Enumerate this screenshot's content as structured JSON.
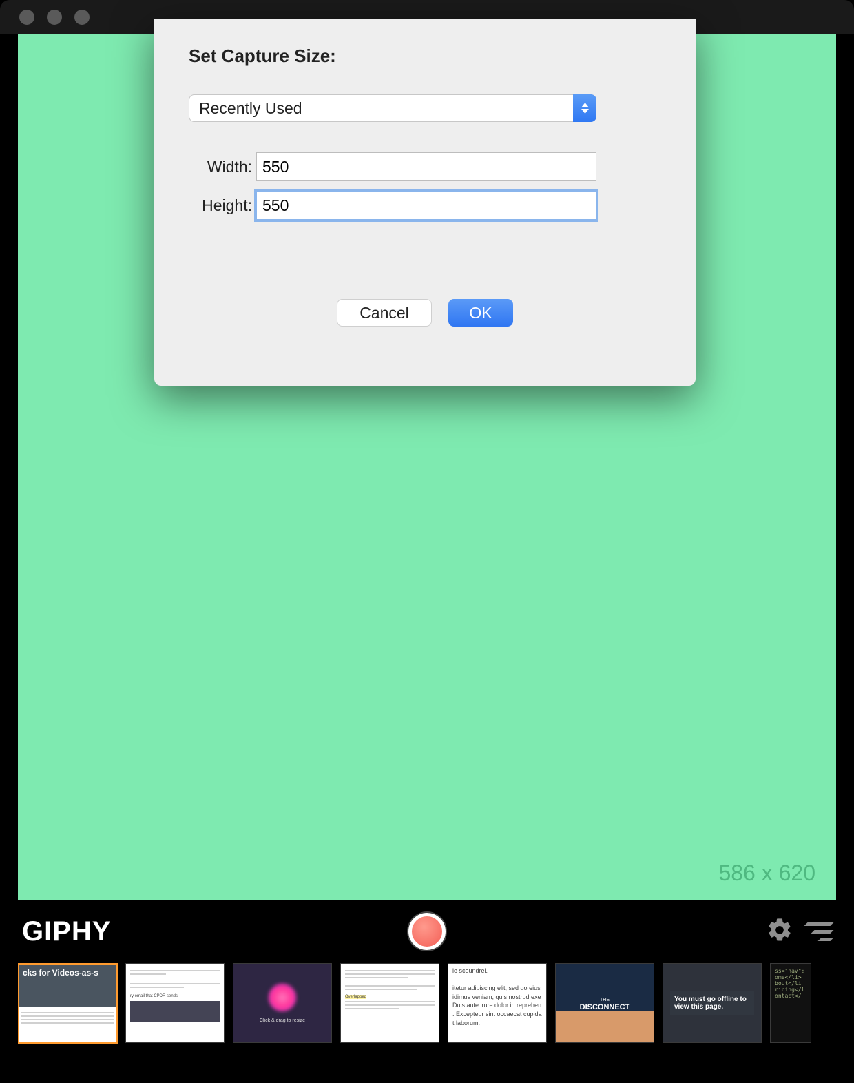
{
  "dialog": {
    "title": "Set Capture Size:",
    "dropdown_value": "Recently Used",
    "width_label": "Width:",
    "width_value": "550",
    "height_label": "Height:",
    "height_value": "550",
    "cancel_label": "Cancel",
    "ok_label": "OK"
  },
  "canvas": {
    "dimensions_label": "586 x 620"
  },
  "bottombar": {
    "brand": "GIPHY"
  },
  "thumbnails": [
    {
      "label": "cks for Videos-as-s"
    },
    {
      "label": "ry email that CPDR sends"
    },
    {
      "label": "Click & drag to resize"
    },
    {
      "label": "Overlapped"
    },
    {
      "label": "ie scoundrel.\n\nitetur adipiscing elit, sed do eius\nidimus veniam, quis nostrud exe\nDuis aute irure dolor in reprehen\n. Excepteur sint occaecat cupida\nt laborum."
    },
    {
      "label": "THE DISCONNECT"
    },
    {
      "label": "You must go offline to view this page."
    },
    {
      "label": "ss=\"nav\":\nome</li>\nbout</li\nricing</l\nontact</"
    }
  ]
}
